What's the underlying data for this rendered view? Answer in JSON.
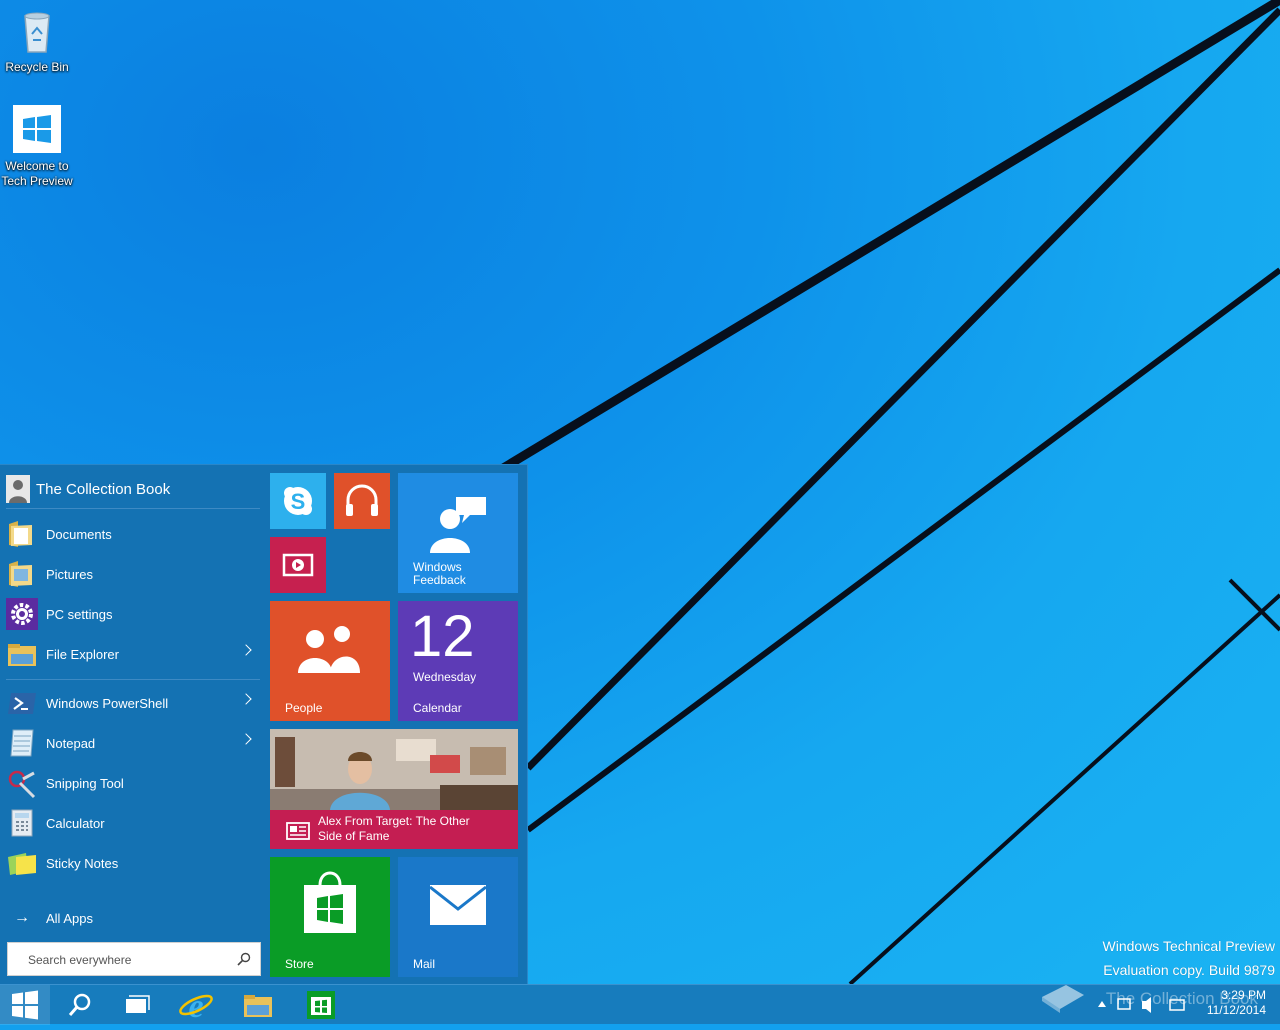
{
  "desktop": {
    "icons": [
      {
        "label": "Recycle Bin"
      },
      {
        "label": "Welcome to Tech Preview"
      }
    ],
    "watermark": {
      "line1": "Windows Technical Preview",
      "line2": "Evaluation copy. Build 9879",
      "brand": "The Collection Book"
    }
  },
  "start_menu": {
    "user_name": "The Collection Book",
    "apps": [
      {
        "label": "Documents",
        "icon": "documents-folder-icon",
        "has_submenu": false
      },
      {
        "label": "Pictures",
        "icon": "pictures-folder-icon",
        "has_submenu": false
      },
      {
        "label": "PC settings",
        "icon": "gear-icon",
        "has_submenu": false
      },
      {
        "label": "File Explorer",
        "icon": "file-explorer-icon",
        "has_submenu": true
      },
      {
        "label": "Windows PowerShell",
        "icon": "powershell-icon",
        "has_submenu": true
      },
      {
        "label": "Notepad",
        "icon": "notepad-icon",
        "has_submenu": true
      },
      {
        "label": "Snipping Tool",
        "icon": "snipping-tool-icon",
        "has_submenu": false
      },
      {
        "label": "Calculator",
        "icon": "calculator-icon",
        "has_submenu": false
      },
      {
        "label": "Sticky Notes",
        "icon": "sticky-notes-icon",
        "has_submenu": false
      }
    ],
    "all_apps_label": "All Apps",
    "search_placeholder": "Search everywhere"
  },
  "tiles": {
    "skype": {
      "icon": "skype-icon",
      "color": "#2db0ed"
    },
    "music": {
      "icon": "headphones-icon",
      "color": "#e0512a"
    },
    "video": {
      "icon": "video-icon",
      "color": "#c6204f"
    },
    "feedback": {
      "label": "Windows Feedback",
      "color": "#1f8ce3"
    },
    "people": {
      "label": "People",
      "color": "#e0512a"
    },
    "calendar": {
      "day_number": "12",
      "weekday": "Wednesday",
      "label": "Calendar",
      "color": "#5d3bb6"
    },
    "news": {
      "headline": "Alex From Target: The Other Side of Fame",
      "color": "#c41e52"
    },
    "store": {
      "label": "Store",
      "color": "#0a9c26"
    },
    "mail": {
      "label": "Mail",
      "color": "#1a78c9"
    }
  },
  "taskbar": {
    "items": [
      "start-button",
      "search-button",
      "task-view-button",
      "internet-explorer-button",
      "file-explorer-button",
      "store-button"
    ],
    "clock_time": "3:29 PM",
    "clock_date": "11/12/2014"
  }
}
